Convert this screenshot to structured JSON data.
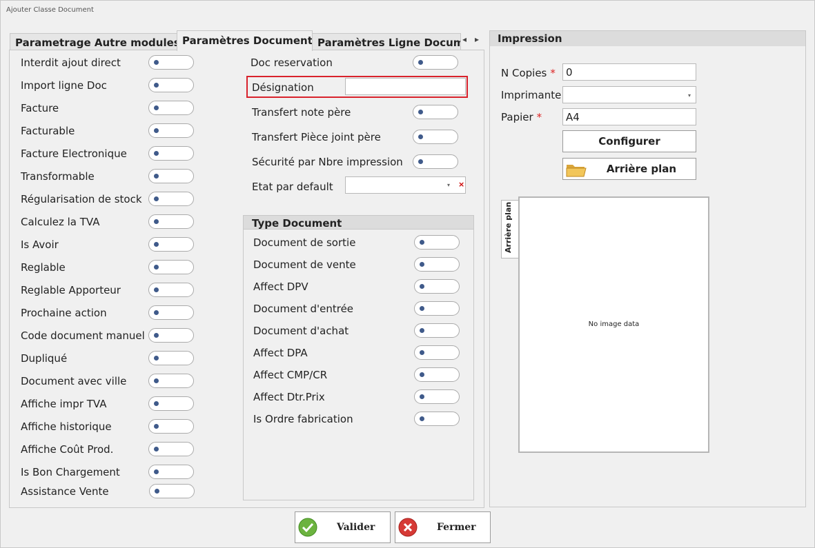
{
  "window": {
    "title": "Ajouter Classe Document"
  },
  "tabs": [
    {
      "label": "Parametrage Autre modules",
      "active": false
    },
    {
      "label": "Paramètres Document",
      "active": true
    },
    {
      "label": "Paramètres Ligne Document",
      "active": false
    }
  ],
  "tab_nav": {
    "prev_symbol": "◂",
    "next_symbol": "▸"
  },
  "left_options": [
    "Interdit ajout direct",
    "Import ligne Doc",
    "Facture",
    "Facturable",
    "Facture Electronique",
    "Transformable",
    "Régularisation de stock",
    "Calculez la TVA",
    "Is Avoir",
    "Reglable",
    "Reglable Apporteur",
    "Prochaine action",
    "Code document manuel",
    "Dupliqué",
    "Document avec ville",
    "Affiche impr TVA",
    "Affiche historique",
    "Affiche Coût Prod.",
    "Is Bon Chargement",
    "Assistance Vente"
  ],
  "middle": {
    "doc_reservation": "Doc reservation",
    "designation_label": "Désignation",
    "designation_value": "",
    "transfert_note": "Transfert note père",
    "transfert_piece": "Transfert Pièce joint père",
    "securite": "Sécurité par Nbre impression",
    "etat_label": "Etat par default",
    "etat_value": "",
    "clear_symbol": "×",
    "dropdown_symbol": "▾"
  },
  "type_document": {
    "title": "Type Document",
    "items": [
      "Document de sortie",
      "Document de vente",
      "Affect DPV",
      "Document d'entrée",
      "Document d'achat",
      "Affect DPA",
      "Affect CMP/CR",
      "Affect Dtr.Prix",
      "Is Ordre fabrication"
    ]
  },
  "impression": {
    "title": "Impression",
    "copies_label": "N Copies",
    "copies_value": "0",
    "imprimante_label": "Imprimante",
    "imprimante_value": "",
    "papier_label": "Papier",
    "papier_value": "A4",
    "required_marker": "*",
    "configurer_label": "Configurer",
    "arriere_plan_label": "Arrière plan",
    "background_tab_label": "Arrière plan",
    "no_image_text": "No image data"
  },
  "footer": {
    "validate_label": "Valider",
    "close_label": "Fermer"
  },
  "colors": {
    "validate_icon": "#6cb33f",
    "close_icon": "#d63a36",
    "highlight_border": "#d8212b",
    "toggle_dot": "#3f5a8a"
  }
}
